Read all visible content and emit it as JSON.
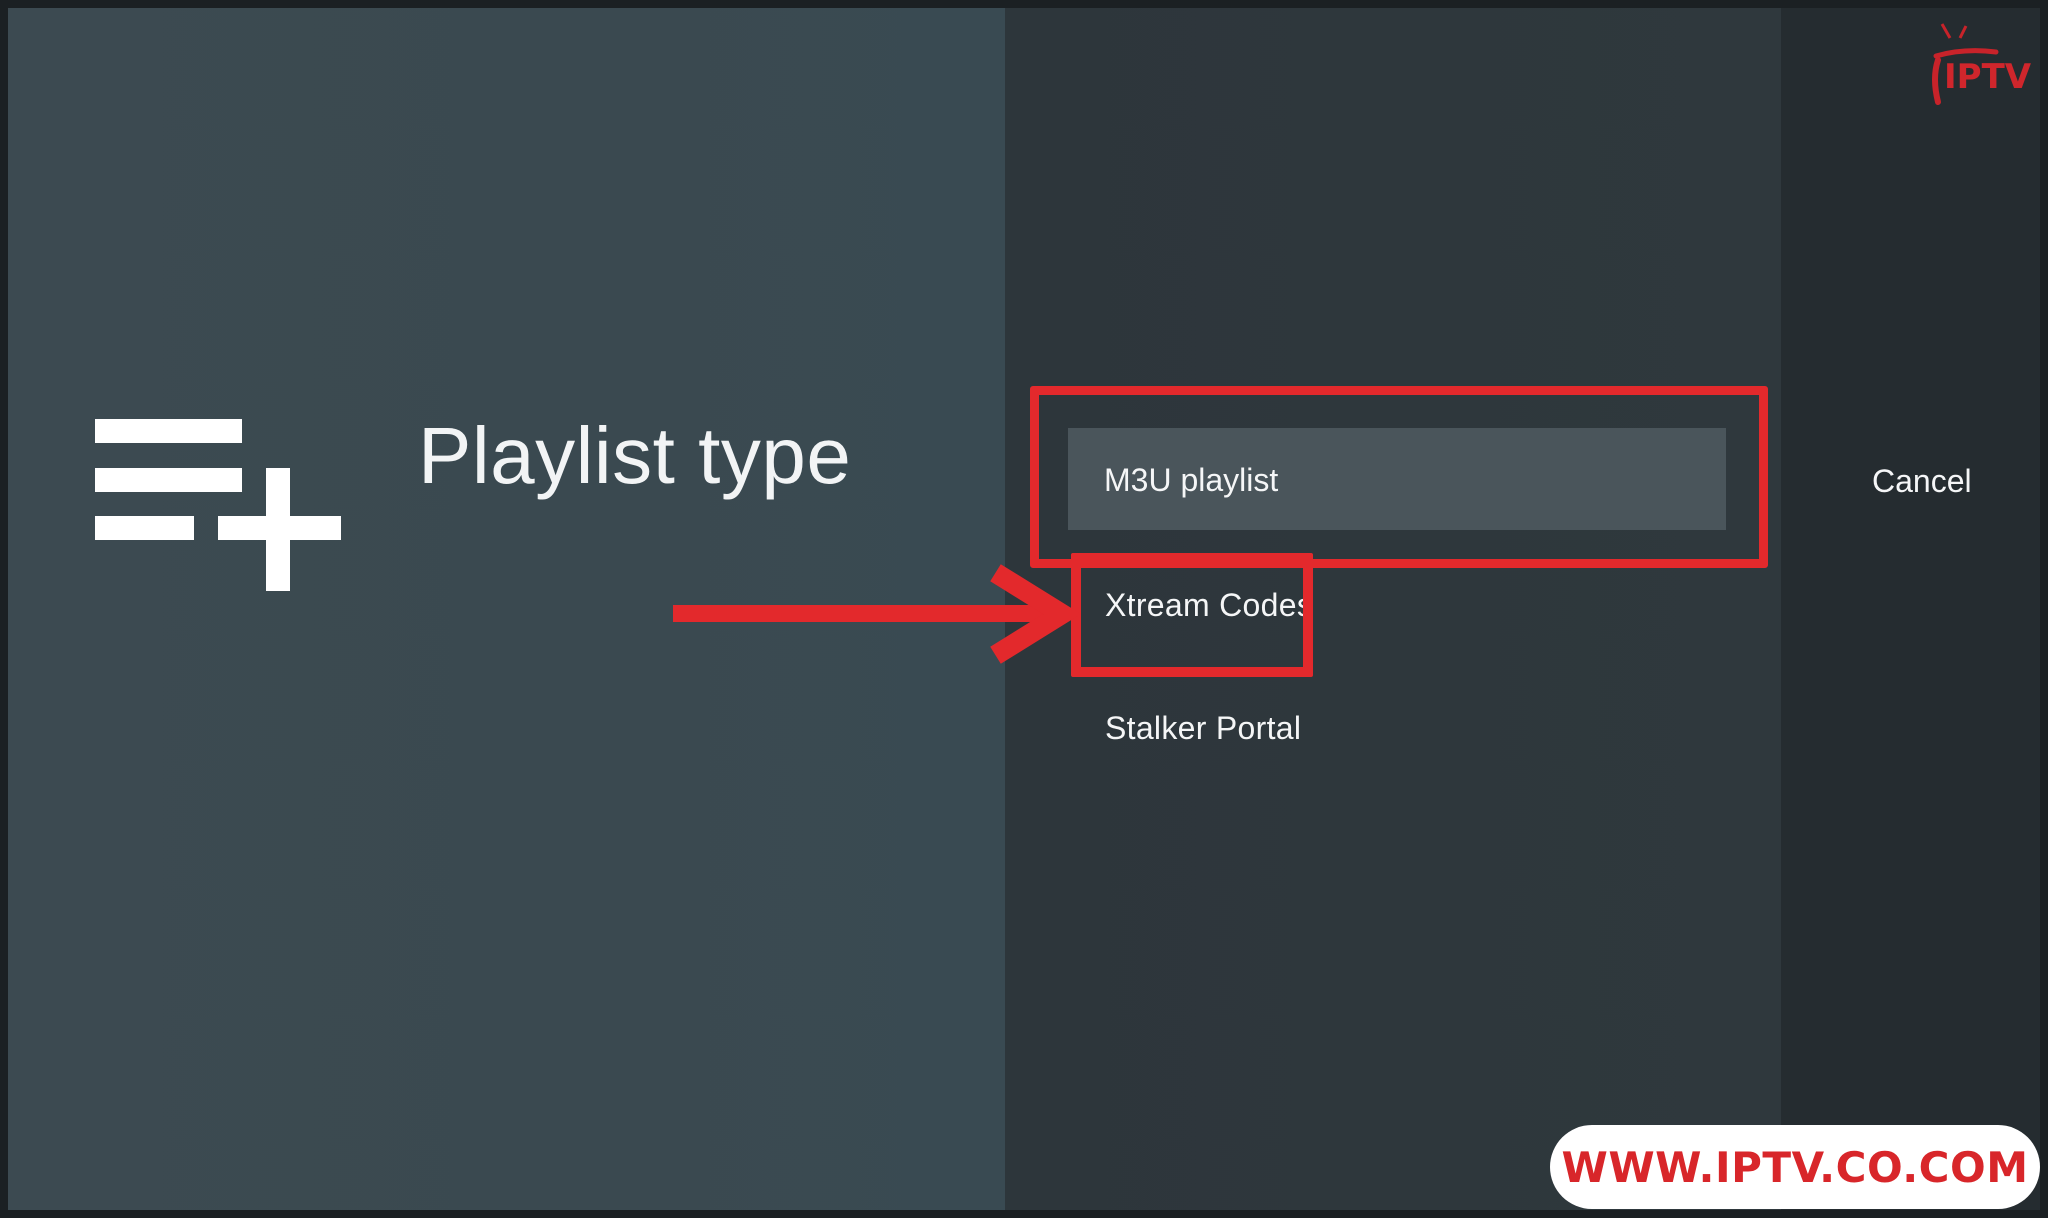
{
  "dialog": {
    "title": "Playlist type",
    "icon": "playlist-add-icon"
  },
  "options": {
    "m3u_label": "M3U playlist",
    "xtream_label": "Xtream Codes",
    "stalker_label": "Stalker Portal",
    "selected": "M3U playlist"
  },
  "actions": {
    "cancel_label": "Cancel"
  },
  "overlay": {
    "brand_logo_text": "IPTV",
    "website": "WWW.IPTV.CO.COM",
    "accent_color": "#e3292c"
  }
}
